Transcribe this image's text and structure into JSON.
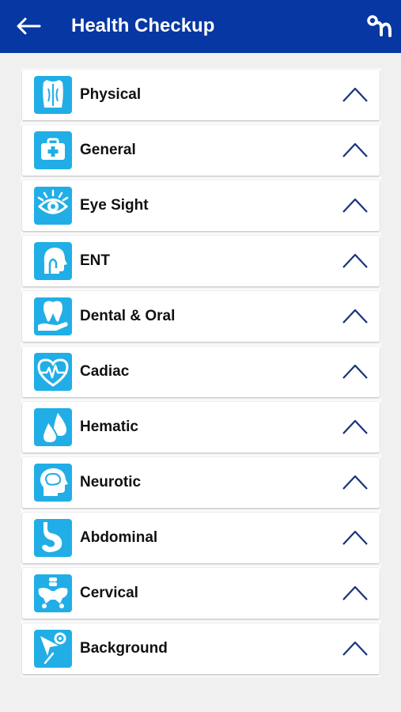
{
  "header": {
    "title": "Health Checkup",
    "bar_color": "#0637a3",
    "back_icon": "arrow-left-icon",
    "logo_icon": "app-logo-icon"
  },
  "accent_color": "#21aee6",
  "categories": [
    {
      "label": "Physical",
      "icon": "body-icon"
    },
    {
      "label": "General",
      "icon": "medical-kit-icon"
    },
    {
      "label": "Eye Sight",
      "icon": "eye-icon"
    },
    {
      "label": "ENT",
      "icon": "head-ent-icon"
    },
    {
      "label": "Dental & Oral",
      "icon": "tooth-icon"
    },
    {
      "label": "Cadiac",
      "icon": "heartbeat-icon"
    },
    {
      "label": "Hematic",
      "icon": "blood-drops-icon"
    },
    {
      "label": "Neurotic",
      "icon": "brain-icon"
    },
    {
      "label": "Abdominal",
      "icon": "stomach-icon"
    },
    {
      "label": "Cervical",
      "icon": "pelvis-icon"
    },
    {
      "label": "Background",
      "icon": "cursor-target-icon"
    }
  ]
}
